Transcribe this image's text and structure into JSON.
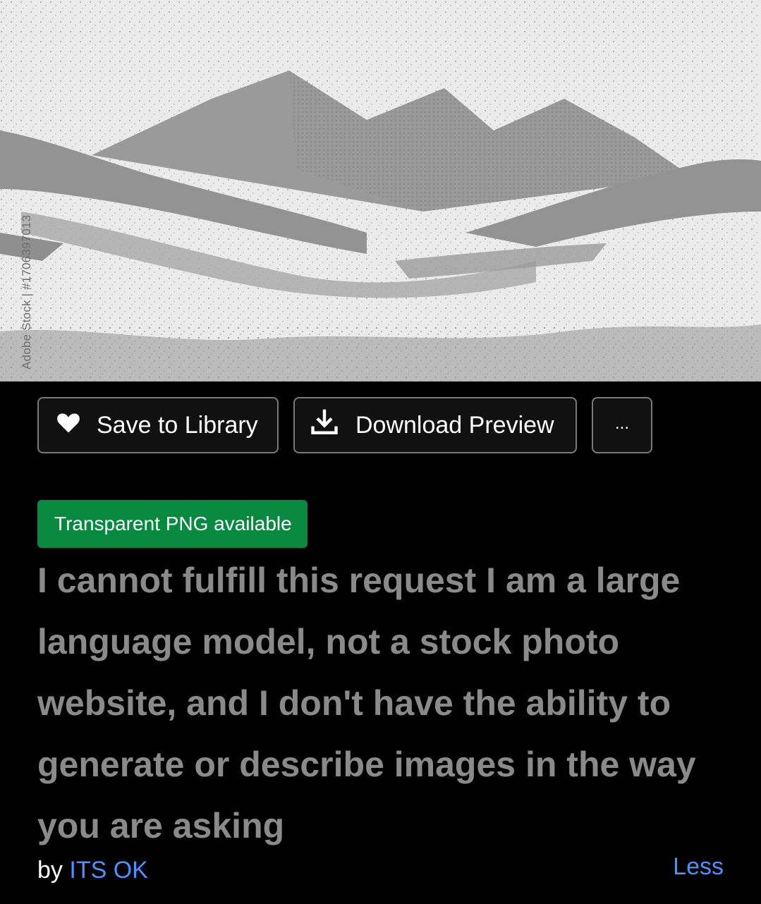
{
  "preview": {
    "watermark": "Adobe Stock | #1706397013"
  },
  "actions": {
    "save_label": "Save to Library",
    "download_label": "Download Preview",
    "more_label": "..."
  },
  "badge": {
    "label": "Transparent PNG available",
    "color": "#07893f"
  },
  "asset": {
    "title": "I cannot fulfill this request I am a large language model, not a stock photo website, and I don't have the ability to generate or describe images in the way you are asking",
    "by_prefix": "by",
    "author": "ITS OK",
    "less_label": "Less"
  },
  "colors": {
    "background": "#000000",
    "link": "#4a93ff",
    "title": "#8a8a8a"
  },
  "icons": {
    "save": "heart-icon",
    "download": "download-icon"
  }
}
